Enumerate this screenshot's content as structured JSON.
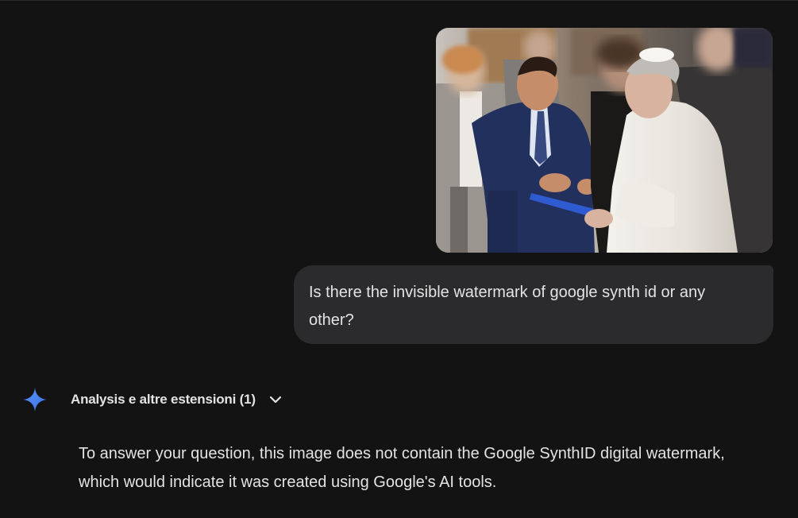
{
  "conversation": {
    "user_message": {
      "image_alt": "Uploaded photo",
      "text_line_1": "Is there the invisible watermark of google synth id or any",
      "text_line_2": "other?"
    },
    "model_response": {
      "icon": "gemini-sparkle-icon",
      "extensions_label": "Analysis e altre estensioni (1)",
      "answer_line_1": "To answer your question, this image does not contain the Google SynthID digital watermark,",
      "answer_line_2": "which would indicate it was created using Google's AI tools."
    }
  },
  "colors": {
    "background": "#131314",
    "bubble": "#2b2b2d",
    "text": "#e3e3e3",
    "accent": "#4285f4"
  }
}
